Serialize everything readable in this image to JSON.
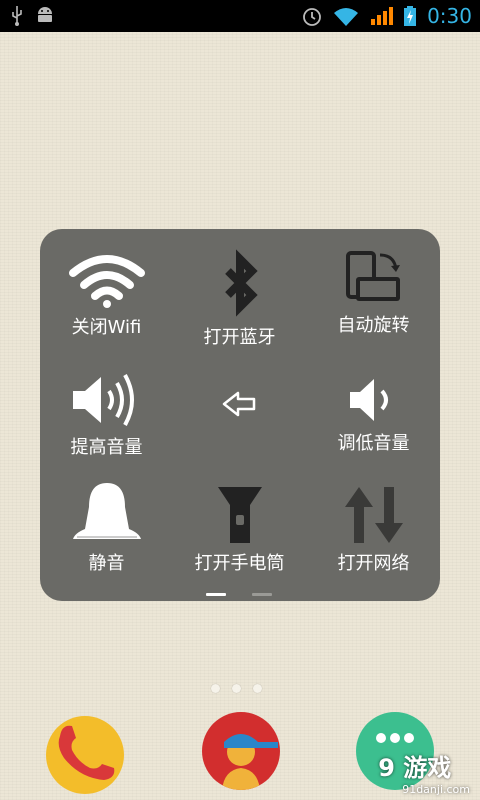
{
  "status_bar": {
    "time": "0:30",
    "icons": [
      "usb-icon",
      "android-icon",
      "alarm-icon",
      "wifi-icon",
      "signal-icon",
      "battery-icon"
    ]
  },
  "quick_panel": {
    "tiles": [
      {
        "label": "关闭Wifi",
        "icon": "wifi-icon"
      },
      {
        "label": "打开蓝牙",
        "icon": "bluetooth-icon"
      },
      {
        "label": "自动旋转",
        "icon": "rotate-icon"
      },
      {
        "label": "提高音量",
        "icon": "volume-up-icon"
      },
      {
        "label": "",
        "icon": "back-arrow-icon"
      },
      {
        "label": "调低音量",
        "icon": "volume-down-icon"
      },
      {
        "label": "静音",
        "icon": "bell-icon"
      },
      {
        "label": "打开手电筒",
        "icon": "flashlight-icon"
      },
      {
        "label": "打开网络",
        "icon": "data-network-icon"
      }
    ],
    "pages": 2,
    "current_page": 1
  },
  "home": {
    "page_dots": 3,
    "dock": [
      "phone-app-icon",
      "contacts-app-icon",
      "messaging-app-icon"
    ]
  },
  "watermark": {
    "main": "9 游戏",
    "sub": "91danji.com"
  },
  "colors": {
    "panel": "#6a6a66",
    "time": "#35b5e5",
    "wifi_status": "#35b5e5",
    "signal_status": "#ff8800"
  }
}
